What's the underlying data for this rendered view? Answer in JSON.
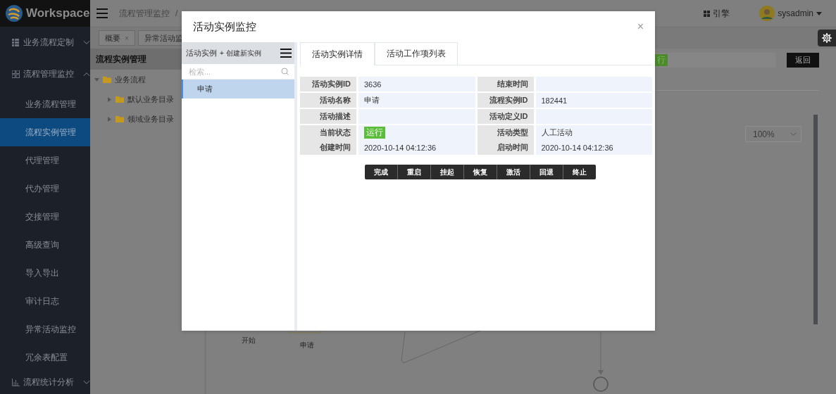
{
  "sidebar": {
    "logo": "Workspace",
    "groups": [
      {
        "label": "业务流程定制",
        "expanded": false
      },
      {
        "label": "流程管理监控",
        "expanded": true,
        "children": [
          {
            "label": "业务流程管理",
            "selected": false
          },
          {
            "label": "流程实例管理",
            "selected": true
          },
          {
            "label": "代理管理",
            "selected": false
          },
          {
            "label": "代办管理",
            "selected": false
          },
          {
            "label": "交接管理",
            "selected": false
          },
          {
            "label": "高级查询",
            "selected": false
          },
          {
            "label": "导入导出",
            "selected": false
          },
          {
            "label": "审计日志",
            "selected": false
          },
          {
            "label": "异常活动监控",
            "selected": false
          },
          {
            "label": "冗余表配置",
            "selected": false
          }
        ]
      },
      {
        "label": "流程统计分析",
        "expanded": false
      }
    ]
  },
  "topbar": {
    "breadcrumb": [
      "流程管理监控",
      "/"
    ],
    "engine": "引擎",
    "user": "sysadmin"
  },
  "tabs": [
    {
      "label": "概要",
      "close": "×"
    },
    {
      "label": "异常活动监"
    }
  ],
  "tree_panel": {
    "title": "流程实例管理",
    "tree": [
      {
        "label": "业务流程",
        "expanded": true,
        "children": [
          {
            "label": "默认业务目录",
            "expanded": false
          },
          {
            "label": "领域业务目录",
            "expanded": false
          }
        ]
      }
    ]
  },
  "toolbar": {
    "status_tag": "行",
    "back_button": "返回"
  },
  "zoom": "100%",
  "diagram": {
    "nodes": [
      {
        "label": "开始"
      },
      {
        "label": "申请"
      }
    ]
  },
  "modal": {
    "title": "活动实例监控",
    "close": "×",
    "list": {
      "title": "活动实例",
      "create": "+ 创建新实例",
      "search_placeholder": "检索...",
      "items": [
        {
          "label": "申请",
          "selected": true
        }
      ]
    },
    "tabs": [
      {
        "label": "活动实例详情",
        "selected": true
      },
      {
        "label": "活动工作项列表",
        "selected": false
      }
    ],
    "rows": [
      {
        "lines": [
          {
            "left": {
              "label": "活动实例ID",
              "value": "3636",
              "kind": "text"
            },
            "right": {
              "label": "结束时间"
            }
          }
        ]
      },
      {
        "lines": [
          {
            "left": {
              "label": "活动名称",
              "value": "申请",
              "kind": "text"
            },
            "right": {
              "label": "流程实例ID",
              "value": "182441",
              "kind": "text"
            }
          }
        ]
      },
      {
        "lines": [
          {
            "left": {
              "label": "活动描述"
            },
            "right": {
              "label": "活动定义ID"
            }
          }
        ]
      },
      {
        "lines": [
          {
            "left": {
              "label": "当前状态",
              "value": "运行",
              "kind": "tag"
            },
            "right": {
              "label": "活动类型",
              "value": "人工活动",
              "kind": "text"
            }
          },
          {
            "left": {
              "label": "创建时间",
              "value": "2020-10-14 04:12:36",
              "kind": "text"
            },
            "right": {
              "label": "启动时间",
              "value": "2020-10-14 04:12:36",
              "kind": "text"
            }
          }
        ]
      }
    ],
    "actions": [
      "完成",
      "重启",
      "挂起",
      "恢复",
      "激活",
      "回退",
      "终止"
    ]
  }
}
